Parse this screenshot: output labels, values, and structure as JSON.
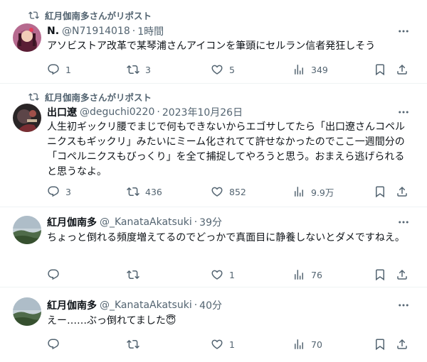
{
  "posts": [
    {
      "repost_by": "紅月伽南多さんがリポスト",
      "name": "N.",
      "handle": "@N71914018",
      "time": "1時間",
      "text": "アソビストア改革で某琴浦さんアイコンを筆頭にセルラン信者発狂しそう",
      "replies": "1",
      "reposts": "3",
      "likes": "5",
      "views": "349"
    },
    {
      "repost_by": "紅月伽南多さんがリポスト",
      "name": "出口遼",
      "handle": "@deguchi0220",
      "time": "2023年10月26日",
      "text": "人生初ギックリ腰でまじで何もできないからエゴサしてたら「出口遼さんコペルニクスもギックリ」みたいにミーム化されてて許せなかったのでここ一週間分の「コペルニクスもびっくり」を全て捕捉してやろうと思う。おまえら逃げられると思うなよ。",
      "replies": "3",
      "reposts": "436",
      "likes": "852",
      "views": "9.9万"
    },
    {
      "name": "紅月伽南多",
      "handle": "@_KanataAkatsuki",
      "time": "39分",
      "text": "ちょっと倒れる頻度増えてるのでどっかで真面目に静養しないとダメですねえ。",
      "likes": "1",
      "views": "76"
    },
    {
      "name": "紅月伽南多",
      "handle": "@_KanataAkatsuki",
      "time": "40分",
      "text": "えー……ぶっ倒れてました😇",
      "likes": "1",
      "views": "70"
    }
  ],
  "sep": "·",
  "colors": {
    "secondary": "#536471",
    "divider": "#eff3f4",
    "text": "#0f1419"
  }
}
